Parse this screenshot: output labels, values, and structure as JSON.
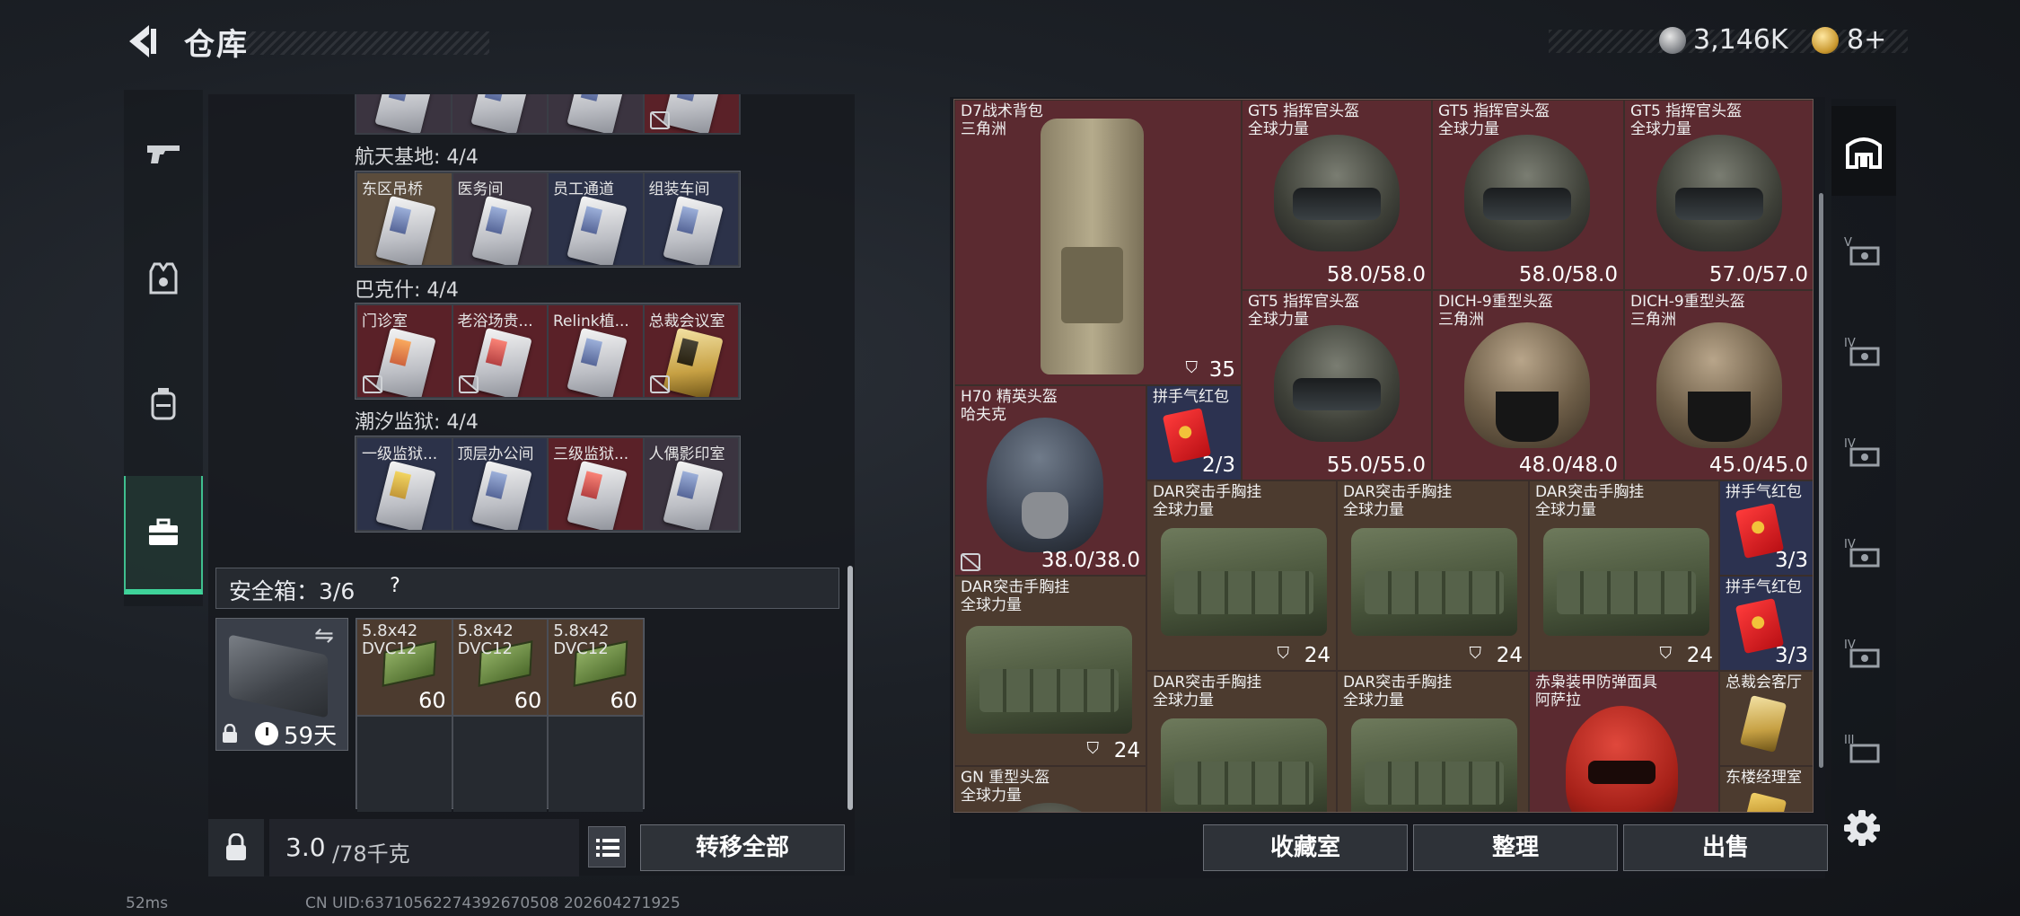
{
  "header": {
    "title": "仓库",
    "currency_silver": "3,146K",
    "currency_gold": "8+"
  },
  "left_sidebar": {
    "items": [
      {
        "icon": "pistol-icon"
      },
      {
        "icon": "armor-vest-icon"
      },
      {
        "icon": "backpack-icon"
      },
      {
        "icon": "briefcase-icon"
      }
    ],
    "active": 3
  },
  "keycards": {
    "top_row": [
      "",
      "",
      "",
      ""
    ],
    "groups": [
      {
        "name": "航天基地: 4/4",
        "cards": [
          {
            "label": "东区吊桥",
            "style": "default"
          },
          {
            "label": "医务间",
            "style": "default"
          },
          {
            "label": "员工通道",
            "style": "default"
          },
          {
            "label": "组装车间",
            "style": "default"
          }
        ]
      },
      {
        "name": "巴克什: 4/4",
        "cards": [
          {
            "label": "门诊室",
            "style": "orange"
          },
          {
            "label": "老浴场贵...",
            "style": "red2"
          },
          {
            "label": "Relink植...",
            "style": "default"
          },
          {
            "label": "总裁会议室",
            "style": "gold"
          }
        ]
      },
      {
        "name": "潮汐监狱: 4/4",
        "cards": [
          {
            "label": "一级监狱...",
            "style": "yel"
          },
          {
            "label": "顶层办公间",
            "style": "default"
          },
          {
            "label": "三级监狱...",
            "style": "red2"
          },
          {
            "label": "人偶影印室",
            "style": "default"
          }
        ]
      }
    ]
  },
  "safebox": {
    "title": "安全箱：3/6",
    "help": "?",
    "days": "59天",
    "swap": "⇋",
    "ammo": [
      {
        "line1": "5.8x42",
        "line2": "DVC12",
        "count": "60"
      },
      {
        "line1": "5.8x42",
        "line2": "DVC12",
        "count": "60"
      },
      {
        "line1": "5.8x42",
        "line2": "DVC12",
        "count": "60"
      }
    ]
  },
  "bottom_left": {
    "weight": "3.0",
    "weight_unit": "/78千克",
    "transfer_all": "转移全部"
  },
  "status": {
    "ping": "52ms",
    "uid": "CN UID:63710562274392670508 202604271925"
  },
  "stash": {
    "items": [
      {
        "id": "d7",
        "name": "D7战术背包",
        "sub": "三角洲",
        "value": "35"
      },
      {
        "id": "gt5a",
        "name": "GT5 指挥官头盔",
        "sub": "全球力量",
        "value": "58.0/58.0"
      },
      {
        "id": "gt5b",
        "name": "GT5 指挥官头盔",
        "sub": "全球力量",
        "value": "58.0/58.0"
      },
      {
        "id": "gt5c",
        "name": "GT5 指挥官头盔",
        "sub": "全球力量",
        "value": "57.0/57.0"
      },
      {
        "id": "gt5d",
        "name": "GT5 指挥官头盔",
        "sub": "全球力量",
        "value": "55.0/55.0"
      },
      {
        "id": "dich1",
        "name": "DICH-9重型头盔",
        "sub": "三角洲",
        "value": "48.0/48.0"
      },
      {
        "id": "dich2",
        "name": "DICH-9重型头盔",
        "sub": "三角洲",
        "value": "45.0/45.0"
      },
      {
        "id": "h70",
        "name": "H70 精英头盔",
        "sub": "哈夫克",
        "value": "38.0/38.0"
      },
      {
        "id": "env1",
        "name": "拼手气红包",
        "sub": "",
        "value": "2/3"
      },
      {
        "id": "dar1",
        "name": "DAR突击手胸挂",
        "sub": "全球力量",
        "value": "24"
      },
      {
        "id": "dar2",
        "name": "DAR突击手胸挂",
        "sub": "全球力量",
        "value": "24"
      },
      {
        "id": "dar3",
        "name": "DAR突击手胸挂",
        "sub": "全球力量",
        "value": "24"
      },
      {
        "id": "env2",
        "name": "拼手气红包",
        "sub": "",
        "value": "3/3"
      },
      {
        "id": "env3",
        "name": "拼手气红包",
        "sub": "",
        "value": "3/3"
      },
      {
        "id": "dar4",
        "name": "DAR突击手胸挂",
        "sub": "全球力量",
        "value": "24"
      },
      {
        "id": "dar5",
        "name": "DAR突击手胸挂",
        "sub": "全球力量",
        "value": ""
      },
      {
        "id": "dar6",
        "name": "DAR突击手胸挂",
        "sub": "全球力量",
        "value": ""
      },
      {
        "id": "red",
        "name": "赤枭装甲防弹面具",
        "sub": "阿萨拉",
        "value": ""
      },
      {
        "id": "card1",
        "name": "总裁会客厅",
        "sub": "",
        "value": ""
      },
      {
        "id": "gn",
        "name": "GN 重型头盔",
        "sub": "全球力量",
        "value": ""
      },
      {
        "id": "card2",
        "name": "东楼经理室",
        "sub": "",
        "value": ""
      }
    ]
  },
  "right_sidebar": {
    "items": [
      {
        "icon": "stash-home-icon"
      },
      {
        "icon": "stash-tab-v-icon",
        "label": "V"
      },
      {
        "icon": "stash-tab-iv-icon",
        "label": "IV"
      },
      {
        "icon": "stash-tab-iv-icon",
        "label": "IV"
      },
      {
        "icon": "stash-tab-iv-icon",
        "label": "IV"
      },
      {
        "icon": "stash-tab-iv-icon",
        "label": "IV"
      },
      {
        "icon": "stash-tab-iii-icon",
        "label": "III"
      }
    ]
  },
  "bottom_right": {
    "collection": "收藏室",
    "sort": "整理",
    "sell": "出售"
  }
}
